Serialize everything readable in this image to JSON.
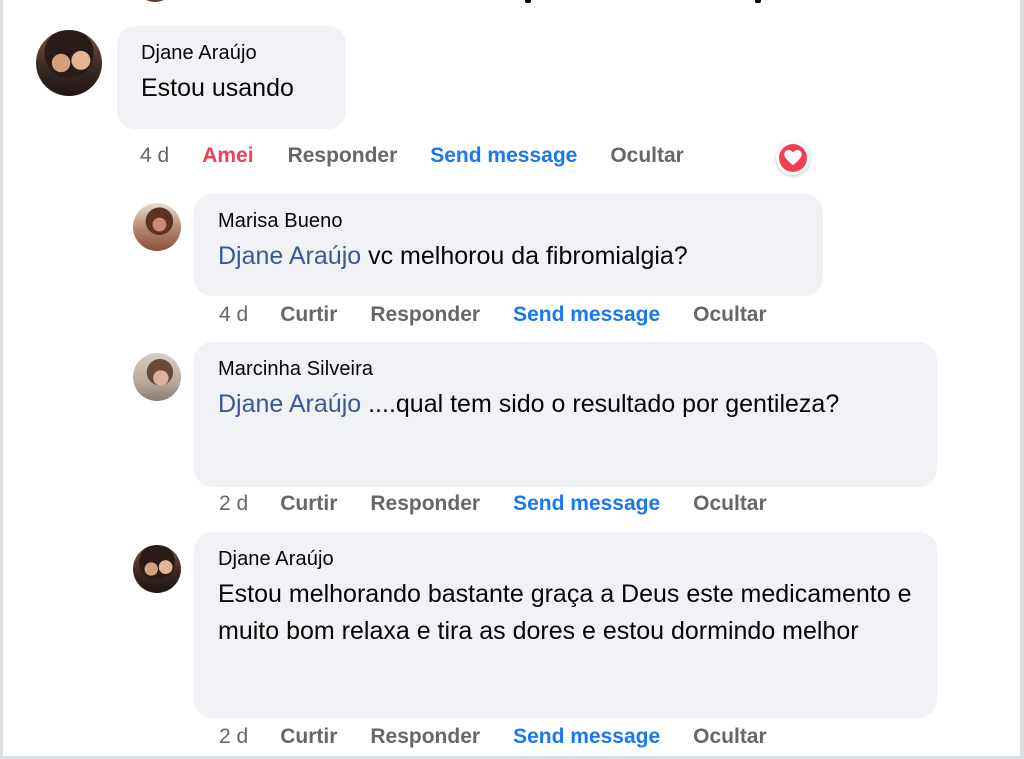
{
  "colors": {
    "bubble_bg": "#f0f2f5",
    "mention": "#385898",
    "loved": "#f33e58",
    "send_message": "#1877f2",
    "meta_text": "#65676b"
  },
  "comments": [
    {
      "author": "Djane Araújo",
      "mention": "",
      "text": "Estou usando",
      "time": "4 d",
      "reaction_label": "Amei",
      "reply_label": "Responder",
      "send_label": "Send message",
      "hide_label": "Ocultar",
      "reaction_icon": "heart-icon",
      "avatar_icon": "profile-photo"
    },
    {
      "author": "Marisa Bueno",
      "mention": "Djane Araújo",
      "text": " vc melhorou da fibromialgia?",
      "time": "4 d",
      "like_label": "Curtir",
      "reply_label": "Responder",
      "send_label": "Send message",
      "hide_label": "Ocultar",
      "avatar_icon": "profile-photo"
    },
    {
      "author": "Marcinha Silveira",
      "mention": "Djane Araújo",
      "text": " ....qual tem sido o resultado por gentileza?",
      "time": "2 d",
      "like_label": "Curtir",
      "reply_label": "Responder",
      "send_label": "Send message",
      "hide_label": "Ocultar",
      "avatar_icon": "profile-photo"
    },
    {
      "author": "Djane Araújo",
      "mention": "",
      "text": "Estou melhorando bastante graça a Deus este medicamento e muito bom relaxa e tira as dores e estou dormindo melhor",
      "time": "2 d",
      "like_label": "Curtir",
      "reply_label": "Responder",
      "send_label": "Send message",
      "hide_label": "Ocultar",
      "avatar_icon": "profile-photo"
    }
  ]
}
